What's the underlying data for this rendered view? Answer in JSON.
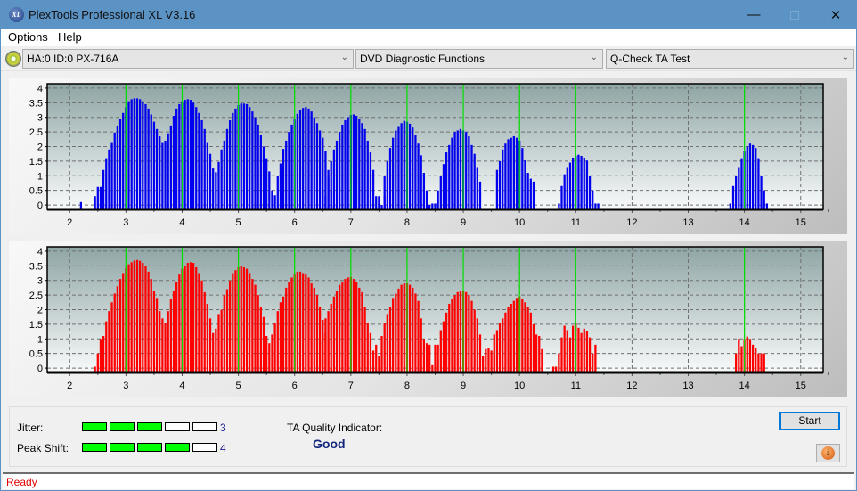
{
  "window": {
    "title": "PlexTools Professional XL V3.16",
    "app_icon_text": "XL"
  },
  "menu": [
    {
      "label": "Options"
    },
    {
      "label": "Help"
    }
  ],
  "toolbar": {
    "drive": "HA:0 ID:0  PX-716A",
    "category": "DVD Diagnostic Functions",
    "test": "Q-Check TA Test"
  },
  "bottom": {
    "jitter_label": "Jitter:",
    "jitter_value": "3",
    "jitter_level": 3,
    "peak_shift_label": "Peak Shift:",
    "peak_shift_value": "4",
    "peak_shift_level": 4,
    "meter_segments": 5,
    "ta_label": "TA Quality Indicator:",
    "ta_value": "Good",
    "start_label": "Start"
  },
  "status": {
    "text": "Ready"
  },
  "colors": {
    "series_top": "#0000ee",
    "series_bottom": "#ff0000",
    "marker": "#00e000",
    "meter_on": "#00ff00"
  },
  "chart_data": [
    {
      "type": "bar",
      "name": "land-ta",
      "color": "#0000ee",
      "xlim": [
        1.6,
        15.4
      ],
      "ylim": [
        -0.15,
        4.15
      ],
      "xticks": [
        2,
        3,
        4,
        5,
        6,
        7,
        8,
        9,
        10,
        11,
        12,
        13,
        14,
        15
      ],
      "yticks": [
        0,
        0.5,
        1,
        1.5,
        2,
        2.5,
        3,
        3.5,
        4
      ],
      "ytick_labels": [
        "0",
        "0.5",
        "1",
        "1.5",
        "2",
        "2.5",
        "3",
        "3.5",
        "4"
      ],
      "markers": [
        3,
        4,
        5,
        6,
        7,
        8,
        9,
        10,
        11,
        14
      ],
      "bar_step": 0.05,
      "groups": [
        {
          "x0": 2.2,
          "values": [
            0.1
          ]
        },
        {
          "x0": 2.45,
          "values": [
            0.3,
            0.62,
            0.62,
            1.2,
            1.6,
            1.9,
            2.15,
            2.48,
            2.72,
            2.95,
            3.15,
            3.35,
            3.55,
            3.62,
            3.65,
            3.65,
            3.62,
            3.55,
            3.45,
            3.3,
            3.1,
            2.85,
            2.6,
            2.35,
            2.15,
            2.2,
            2.45,
            2.72,
            3.05,
            3.3,
            3.45,
            3.55,
            3.6,
            3.62,
            3.6,
            3.5,
            3.35,
            3.15,
            2.9,
            2.6,
            2.15,
            1.75,
            1.25,
            1.12,
            1.47,
            1.9,
            2.2,
            2.6,
            2.9,
            3.15,
            3.3,
            3.42,
            3.47,
            3.47,
            3.45,
            3.35,
            3.2,
            3.0,
            2.75,
            2.4,
            2.0,
            1.6,
            1.15,
            0.5,
            0.33,
            1.0,
            1.42,
            1.92,
            2.2,
            2.5,
            2.75,
            2.95,
            3.12,
            3.25,
            3.32,
            3.35,
            3.3,
            3.2,
            3.0,
            2.8,
            2.55,
            2.3,
            1.85,
            1.2,
            0.5,
            0.0
          ]
        },
        {
          "x0": 6.5,
          "values": [
            0.5,
            0.3,
            0.95,
            1.5,
            1.9,
            2.2,
            2.5,
            2.75,
            2.9,
            3.0,
            3.08,
            3.1,
            3.05,
            2.95,
            2.8,
            2.6,
            2.2,
            1.8,
            1.2,
            0.3,
            0.3,
            0.0,
            0.3
          ]
        },
        {
          "x0": 7.6,
          "values": [
            1.0,
            1.5,
            1.95,
            2.3,
            2.55,
            2.7,
            2.8,
            2.88,
            2.85,
            2.78,
            2.65,
            2.4,
            2.1,
            1.7,
            1.1,
            0.5,
            0.0
          ]
        },
        {
          "x0": 8.45,
          "values": [
            0.05,
            0.05,
            0.5,
            1.0,
            1.4,
            1.8,
            2.05,
            2.3,
            2.5,
            2.55,
            2.6,
            2.55,
            2.5,
            2.35,
            2.05,
            1.75,
            1.3,
            0.8
          ]
        },
        {
          "x0": 9.6,
          "values": [
            1.2,
            1.5,
            1.9,
            2.1,
            2.25,
            2.3,
            2.35,
            2.3,
            2.2,
            1.95,
            1.55,
            1.1,
            0.9,
            0.8
          ]
        },
        {
          "x0": 10.7,
          "values": [
            0.05,
            0.65,
            1.05,
            1.3,
            1.45,
            1.62,
            1.68,
            1.72,
            1.68,
            1.62,
            1.52,
            1.0,
            0.5,
            0.05,
            0.05
          ]
        },
        {
          "x0": 13.75,
          "values": [
            0.05,
            0.65,
            1.0,
            1.3,
            1.6,
            1.85,
            2.0,
            2.1,
            2.05,
            1.95,
            1.6,
            1.0,
            0.5,
            0.05
          ]
        }
      ]
    },
    {
      "type": "bar",
      "name": "groove-ta",
      "color": "#ff0000",
      "xlim": [
        1.6,
        15.4
      ],
      "ylim": [
        -0.15,
        4.15
      ],
      "xticks": [
        2,
        3,
        4,
        5,
        6,
        7,
        8,
        9,
        10,
        11,
        12,
        13,
        14,
        15
      ],
      "yticks": [
        0,
        0.5,
        1,
        1.5,
        2,
        2.5,
        3,
        3.5,
        4
      ],
      "ytick_labels": [
        "0",
        "0.5",
        "1",
        "1.5",
        "2",
        "2.5",
        "3",
        "3.5",
        "4"
      ],
      "markers": [
        3,
        4,
        5,
        6,
        7,
        8,
        9,
        10,
        11,
        14
      ],
      "bar_step": 0.05,
      "groups": [
        {
          "x0": 2.45,
          "values": [
            0.05,
            0.5,
            1.0,
            1.1,
            1.6,
            1.95,
            2.25,
            2.55,
            2.8,
            3.05,
            3.25,
            3.42,
            3.55,
            3.62,
            3.68,
            3.7,
            3.67,
            3.6,
            3.48,
            3.3,
            3.05,
            2.65,
            2.4,
            1.95,
            1.7,
            1.55,
            1.95,
            2.35,
            2.65,
            2.95,
            3.2,
            3.4,
            3.5,
            3.6,
            3.62,
            3.6,
            3.45,
            3.25,
            3.0,
            2.6,
            2.2,
            1.7,
            1.2,
            1.35,
            1.85,
            2.0,
            2.5,
            2.7,
            3.0,
            3.25,
            3.35,
            3.45,
            3.48,
            3.45,
            3.4,
            3.25,
            3.05,
            2.85,
            2.5,
            2.1,
            1.75,
            1.1,
            0.85,
            1.15,
            1.55,
            1.95,
            2.25,
            2.45,
            2.75,
            2.95,
            3.1,
            3.2,
            3.3,
            3.3,
            3.25,
            3.2,
            3.1,
            2.9,
            2.75,
            2.5,
            2.1,
            1.65,
            1.2,
            0.95,
            0.0
          ]
        },
        {
          "x0": 6.45,
          "values": [
            0.95,
            1.2,
            1.7,
            1.95,
            2.2,
            2.45,
            2.65,
            2.85,
            2.95,
            3.05,
            3.1,
            3.12,
            3.05,
            2.95,
            2.75,
            2.6,
            2.1,
            1.55,
            1.2,
            0.6,
            0.8,
            0.4
          ]
        },
        {
          "x0": 7.55,
          "values": [
            1.1,
            1.55,
            1.85,
            2.1,
            2.4,
            2.55,
            2.72,
            2.85,
            2.9,
            2.9,
            2.85,
            2.75,
            2.55,
            2.3,
            1.7,
            1.0,
            0.85,
            0.8,
            0.1,
            0.8,
            0.8
          ]
        },
        {
          "x0": 8.6,
          "values": [
            1.3,
            1.6,
            1.9,
            2.2,
            2.35,
            2.5,
            2.6,
            2.65,
            2.65,
            2.6,
            2.5,
            2.3,
            2.0,
            1.7,
            1.15,
            0.4,
            0.65,
            0.7,
            0.6,
            0.4
          ]
        },
        {
          "x0": 9.55,
          "values": [
            1.15,
            1.3,
            1.55,
            1.7,
            1.9,
            2.1,
            2.2,
            2.3,
            2.4,
            2.45,
            2.35,
            2.25,
            2.1,
            1.9,
            1.5,
            1.15,
            1.1,
            0.65
          ]
        },
        {
          "x0": 10.6,
          "values": [
            0.05,
            0.05,
            0.5,
            1.05,
            1.45,
            1.3,
            1.05,
            1.45,
            1.55,
            1.38,
            1.2,
            1.35,
            1.28,
            1.05,
            0.5,
            0.8
          ]
        },
        {
          "x0": 13.85,
          "values": [
            0.5,
            1.0,
            0.75,
            1.0,
            1.08,
            1.0,
            0.8,
            0.68,
            0.5,
            0.5,
            0.5
          ]
        }
      ]
    }
  ]
}
